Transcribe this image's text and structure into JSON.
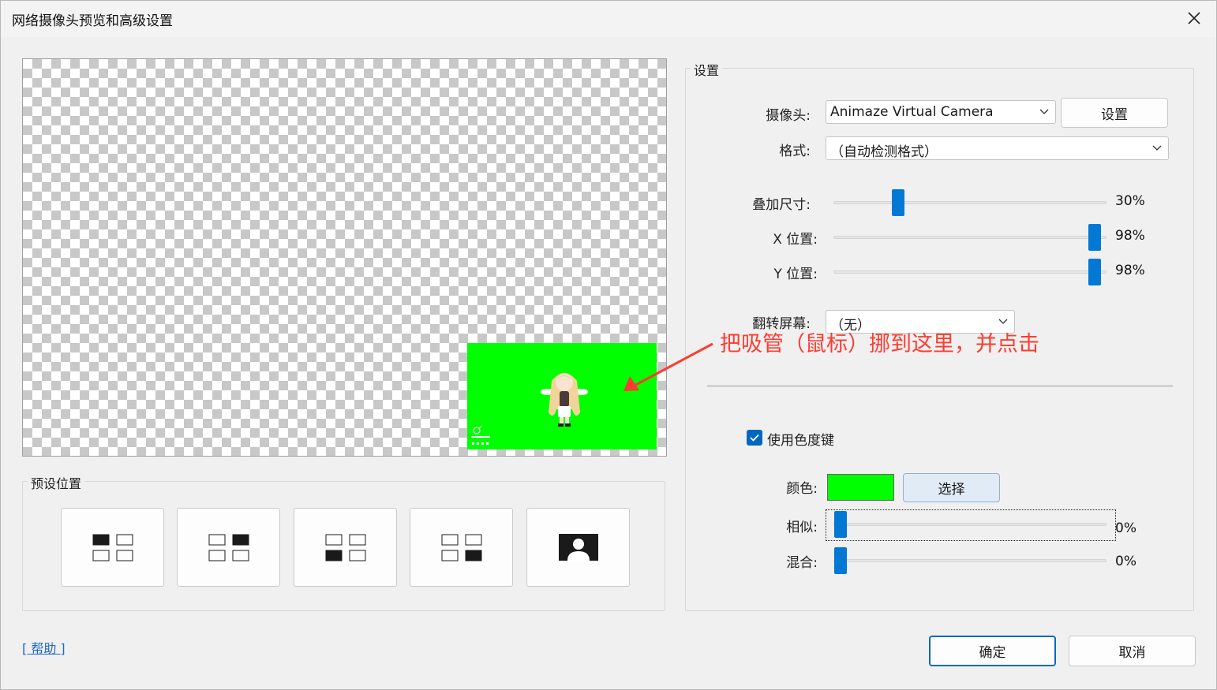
{
  "window": {
    "title": "网络摄像头预览和高级设置"
  },
  "preview": {
    "overlay_color": "#00ff00",
    "watermark": "animaze FREE"
  },
  "presets": {
    "label": "预设位置",
    "buttons": [
      "top-left",
      "top-right",
      "bottom-left",
      "bottom-right",
      "fullscreen"
    ]
  },
  "help": {
    "label": "[ 帮助 ]"
  },
  "settings": {
    "label": "设置",
    "camera": {
      "label": "摄像头:",
      "value": "Animaze Virtual Camera",
      "settings_button": "设置"
    },
    "format": {
      "label": "格式:",
      "value": "（自动检测格式）"
    },
    "overlay_size": {
      "label": "叠加尺寸:",
      "value": 30,
      "value_text": "30%"
    },
    "x_pos": {
      "label": "X 位置:",
      "value": 98,
      "value_text": "98%"
    },
    "y_pos": {
      "label": "Y 位置:",
      "value": 98,
      "value_text": "98%"
    },
    "flip": {
      "label": "翻转屏幕:",
      "value": "（无）"
    },
    "chroma": {
      "checkbox_label": "使用色度键",
      "checked": true,
      "color_label": "颜色:",
      "color_value": "#00ff00",
      "pick_button": "选择",
      "similarity": {
        "label": "相似:",
        "value": 0,
        "value_text": "0%"
      },
      "blend": {
        "label": "混合:",
        "value": 0,
        "value_text": "0%"
      }
    }
  },
  "footer": {
    "ok": "确定",
    "cancel": "取消"
  },
  "annotation": {
    "text": "把吸管（鼠标）挪到这里，并点击",
    "color": "#ff3b30"
  }
}
